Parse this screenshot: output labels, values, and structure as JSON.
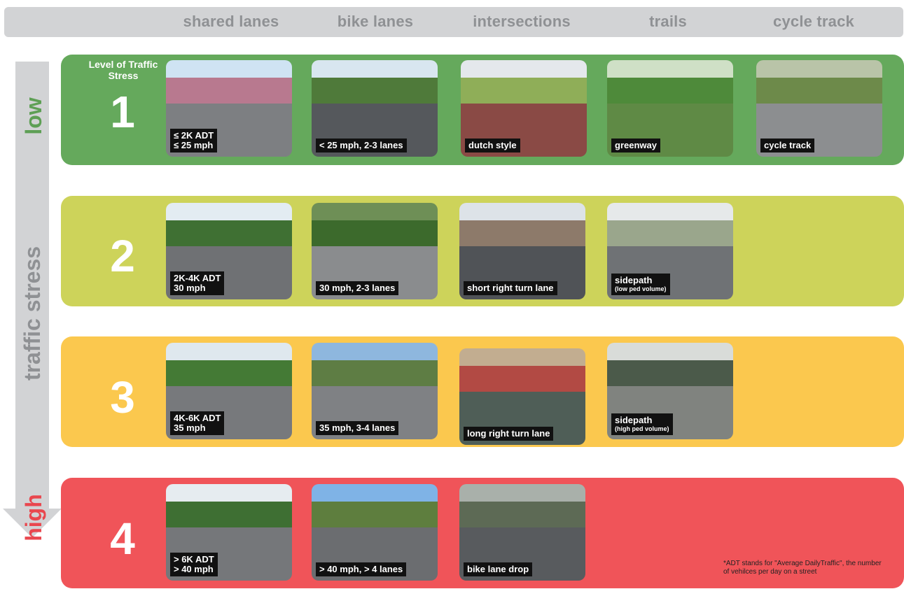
{
  "columns": [
    "shared lanes",
    "bike lanes",
    "intersections",
    "trails",
    "cycle track"
  ],
  "axis": {
    "low": "low",
    "middle": "traffic stress",
    "high": "high"
  },
  "level_title": "Level of Traffic Stress",
  "levels": [
    {
      "number": "1",
      "color": "#65a95c",
      "photos": [
        {
          "caption": "≤ 2K ADT\n≤ 25 mph",
          "subcaption": ""
        },
        {
          "caption": "< 25 mph, 2-3 lanes",
          "subcaption": ""
        },
        {
          "caption": "dutch style",
          "subcaption": ""
        },
        {
          "caption": "greenway",
          "subcaption": ""
        },
        {
          "caption": "cycle track",
          "subcaption": ""
        }
      ]
    },
    {
      "number": "2",
      "color": "#cdd35a",
      "photos": [
        {
          "caption": "2K-4K ADT\n30 mph",
          "subcaption": ""
        },
        {
          "caption": "30 mph, 2-3 lanes",
          "subcaption": ""
        },
        {
          "caption": "short right turn lane",
          "subcaption": ""
        },
        {
          "caption": "sidepath",
          "subcaption": "(low ped volume)"
        }
      ]
    },
    {
      "number": "3",
      "color": "#fbc84e",
      "photos": [
        {
          "caption": "4K-6K ADT\n35 mph",
          "subcaption": ""
        },
        {
          "caption": "35 mph, 3-4 lanes",
          "subcaption": ""
        },
        {
          "caption": "long right turn lane",
          "subcaption": ""
        },
        {
          "caption": "sidepath",
          "subcaption": "(high ped volume)"
        }
      ]
    },
    {
      "number": "4",
      "color": "#f05459",
      "photos": [
        {
          "caption": "> 6K ADT\n> 40 mph",
          "subcaption": ""
        },
        {
          "caption": "> 40 mph, > 4 lanes",
          "subcaption": ""
        },
        {
          "caption": "bike lane drop",
          "subcaption": ""
        }
      ]
    }
  ],
  "footnote": "*ADT stands for \"Average DailyTraffic\", the number of vehilces per day on a street"
}
